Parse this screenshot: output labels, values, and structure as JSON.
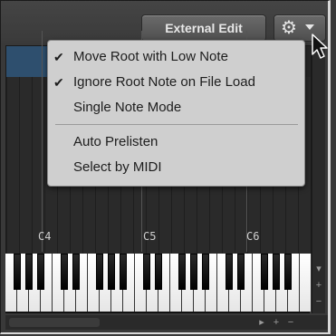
{
  "toolbar": {
    "external_edit_label": "External Edit"
  },
  "menu": {
    "items": [
      {
        "label": "Move Root with Low Note",
        "checked": true,
        "check_mark": "✔"
      },
      {
        "label": "Ignore Root Note on File Load",
        "checked": true,
        "check_mark": "✔"
      },
      {
        "label": "Single Note Mode",
        "checked": false,
        "check_mark": ""
      },
      {
        "label": "Auto Prelisten",
        "checked": false,
        "check_mark": ""
      },
      {
        "label": "Select by MIDI",
        "checked": false,
        "check_mark": ""
      }
    ]
  },
  "keyboard": {
    "octave_labels": [
      "C4",
      "C5",
      "C6"
    ]
  },
  "icons": {
    "gear": "gear-icon",
    "dropdown": "chevron-down-icon",
    "cursor": "mouse-pointer-icon"
  },
  "colors": {
    "accent_header": "#2e4f6e",
    "menu_background": "#cfcfcf",
    "button_face": "#5a5a5a"
  }
}
